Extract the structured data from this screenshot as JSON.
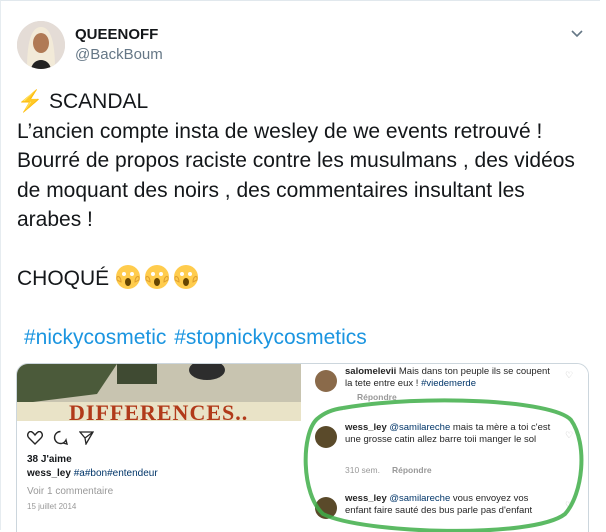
{
  "user": {
    "display_name": "QUEENOFF",
    "handle": "@BackBoum"
  },
  "tweet": {
    "line1": "⚡ SCANDAL",
    "body": "L’ancien compte insta de wesley de we events retrouvé ! Bourré de propos raciste contre les musulmans , des vidéos de moquant des noirs , des commentaires insultant les arabes !",
    "choque": "CHOQUÉ",
    "hashtags": [
      "#nickycosmetic",
      "#stopnickycosmetics"
    ]
  },
  "left_post": {
    "photo_text": "DIFFERENCES..",
    "likes": "38 J'aime",
    "caption_user": "wess_ley",
    "caption_tags": "#a#bon#entendeur",
    "comments_link": "Voir 1 commentaire",
    "date": "15 juillet 2014"
  },
  "right_post": {
    "comments": [
      {
        "user": "salomelevii",
        "text": "Mais dans ton peuple ils se coupent la tete entre eux !",
        "tag": "#viedemerde",
        "meta_time": "",
        "meta_reply": "Répondre"
      },
      {
        "user": "wess_ley",
        "mention": "@samilareche",
        "text": "mais ta mère a toi c'est une grosse catin  allez barre toii manger le sol",
        "meta_time": "310 sem.",
        "meta_reply": "Répondre"
      },
      {
        "user": "wess_ley",
        "mention": "@samilareche",
        "text": "vous envoyez vos enfant faire sauté des bus parle pas d'enfant"
      }
    ]
  },
  "icons": {
    "chevron": "chevron-down-icon",
    "lightning": "lightning-emoji",
    "scream": "screaming-face-emoji",
    "heart": "heart-icon",
    "comment": "comment-icon",
    "share": "share-icon"
  }
}
